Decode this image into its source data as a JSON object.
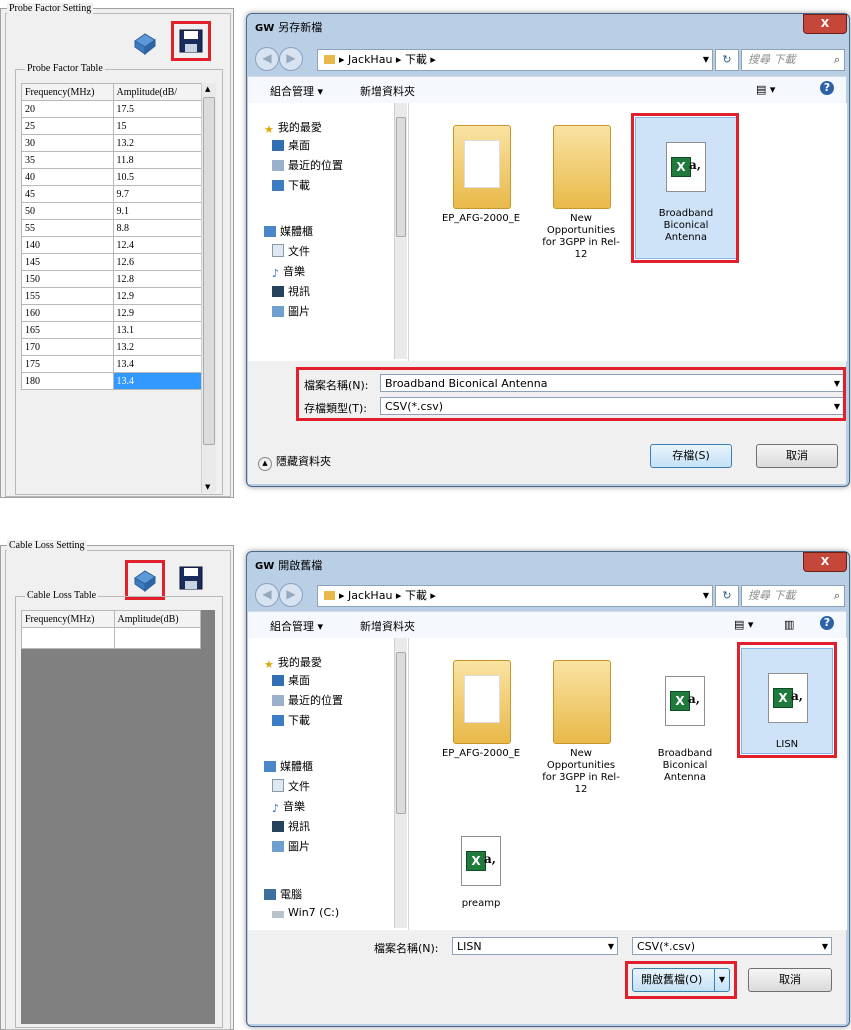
{
  "top": {
    "panel_title": "Probe Factor Setting",
    "table_title": "Probe Factor Table",
    "columns": [
      "Frequency(MHz)",
      "Amplitude(dB/"
    ],
    "rows": [
      [
        "20",
        "17.5"
      ],
      [
        "25",
        "15"
      ],
      [
        "30",
        "13.2"
      ],
      [
        "35",
        "11.8"
      ],
      [
        "40",
        "10.5"
      ],
      [
        "45",
        "9.7"
      ],
      [
        "50",
        "9.1"
      ],
      [
        "55",
        "8.8"
      ],
      [
        "140",
        "12.4"
      ],
      [
        "145",
        "12.6"
      ],
      [
        "150",
        "12.8"
      ],
      [
        "155",
        "12.9"
      ],
      [
        "160",
        "12.9"
      ],
      [
        "165",
        "13.1"
      ],
      [
        "170",
        "13.2"
      ],
      [
        "175",
        "13.4"
      ],
      [
        "180",
        "13.4"
      ]
    ],
    "dialog": {
      "title": "另存新檔",
      "close": "X",
      "breadcrumb": [
        "JackHau",
        "下載"
      ],
      "search_placeholder": "搜尋 下載",
      "organize": "組合管理 ▾",
      "new_folder": "新增資料夾",
      "nav": {
        "favorites": "我的最愛",
        "desktop": "桌面",
        "recent": "最近的位置",
        "downloads": "下載",
        "libraries": "媒體櫃",
        "documents": "文件",
        "music": "音樂",
        "videos": "視訊",
        "pictures": "圖片"
      },
      "files": [
        {
          "name": "EP_AFG-2000_E",
          "type": "folder"
        },
        {
          "name": "New Opportunities for 3GPP in Rel-12",
          "type": "folder"
        },
        {
          "name": "Broadband Biconical Antenna",
          "type": "csv"
        }
      ],
      "filename_label": "檔案名稱(N):",
      "filename_value": "Broadband Biconical Antenna",
      "filetype_label": "存檔類型(T):",
      "filetype_value": "CSV(*.csv)",
      "hide_folders": "隱藏資料夾",
      "save": "存檔(S)",
      "cancel": "取消"
    }
  },
  "bottom": {
    "panel_title": "Cable Loss Setting",
    "table_title": "Cable Loss Table",
    "columns": [
      "Frequency(MHz)",
      "Amplitude(dB)"
    ],
    "dialog": {
      "title": "開啟舊檔",
      "close": "X",
      "breadcrumb": [
        "JackHau",
        "下載"
      ],
      "search_placeholder": "搜尋 下載",
      "organize": "組合管理 ▾",
      "new_folder": "新增資料夾",
      "nav": {
        "favorites": "我的最愛",
        "desktop": "桌面",
        "recent": "最近的位置",
        "downloads": "下載",
        "libraries": "媒體櫃",
        "documents": "文件",
        "music": "音樂",
        "videos": "視訊",
        "pictures": "圖片",
        "computer": "電腦",
        "drive": "Win7 (C:)"
      },
      "files": [
        {
          "name": "EP_AFG-2000_E",
          "type": "folder"
        },
        {
          "name": "New Opportunities for 3GPP in Rel-12",
          "type": "folder"
        },
        {
          "name": "Broadband Biconical Antenna",
          "type": "csv"
        },
        {
          "name": "LISN",
          "type": "csv"
        },
        {
          "name": "preamp",
          "type": "csv"
        }
      ],
      "filename_label": "檔案名稱(N):",
      "filename_value": "LISN",
      "filetype_value": "CSV(*.csv)",
      "open": "開啟舊檔(O)",
      "cancel": "取消"
    }
  }
}
